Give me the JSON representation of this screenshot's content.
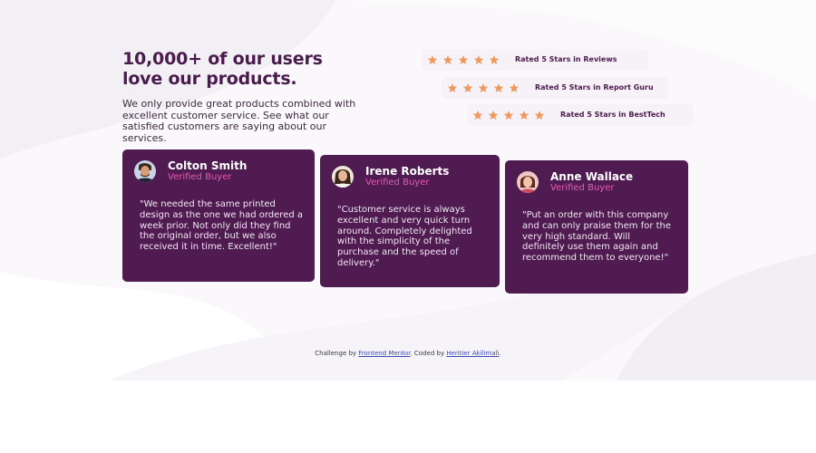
{
  "header": {
    "heading_line1": "10,000+ of our users",
    "heading_line2": "love our products.",
    "intro": "We only provide great products combined with excellent customer service. See what our satisfied customers are saying about our services."
  },
  "ratings": [
    {
      "stars": 5,
      "label": "Rated 5 Stars in Reviews"
    },
    {
      "stars": 5,
      "label": "Rated 5 Stars in Report Guru"
    },
    {
      "stars": 5,
      "label": "Rated 5 Stars in BestTech"
    }
  ],
  "testimonials": [
    {
      "name": "Colton Smith",
      "status": "Verified Buyer",
      "quote": "\"We needed the same printed design as the one we had ordered a week prior. Not only did they find the original order, but we also received it in time. Excellent!\""
    },
    {
      "name": "Irene Roberts",
      "status": "Verified Buyer",
      "quote": "\"Customer service is always excellent and very quick turn around. Completely delighted with the simplicity of the purchase and the speed of delivery.\""
    },
    {
      "name": "Anne Wallace",
      "status": "Verified Buyer",
      "quote": "\"Put an order with this company and can only praise them for the very high standard. Will definitely use them again and recommend them to everyone!\""
    }
  ],
  "footer": {
    "prefix": "Challenge by ",
    "challenge_link": "Frontend Mentor",
    "middle": ". Coded by ",
    "author_link": "Heritier Akilimali",
    "suffix": "."
  },
  "colors": {
    "accent": "#4f1b51",
    "star": "#ee9a5e",
    "verified": "#e65bb0",
    "rating_bg": "#f7f2f8"
  },
  "icons": [
    "star-icon"
  ]
}
